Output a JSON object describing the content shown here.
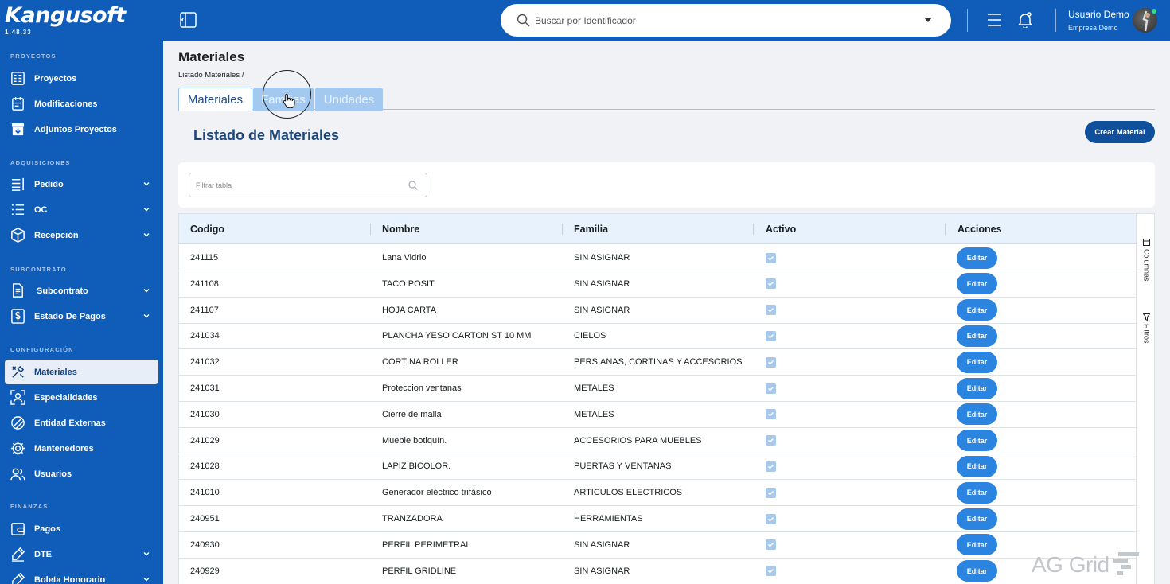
{
  "app": {
    "logo": "Kangusoft",
    "version": "1.48.33"
  },
  "sidebar": {
    "sections": [
      {
        "title": "PROYECTOS",
        "items": [
          {
            "label": "Proyectos",
            "icon": "projects-icon"
          },
          {
            "label": "Modificaciones",
            "icon": "modifications-icon"
          },
          {
            "label": "Adjuntos Proyectos",
            "icon": "attachments-icon"
          }
        ]
      },
      {
        "title": "ADQUISICIONES",
        "items": [
          {
            "label": "Pedido",
            "icon": "order-icon"
          },
          {
            "label": "OC",
            "icon": "purchase-order-icon"
          },
          {
            "label": "Recepción",
            "icon": "reception-icon"
          }
        ]
      },
      {
        "title": "SUBCONTRATO",
        "items": [
          {
            "label": "Subcontrato",
            "icon": "subcontract-icon"
          },
          {
            "label": "Estado De Pagos",
            "icon": "payment-status-icon"
          }
        ]
      },
      {
        "title": "CONFIGURACIÓN",
        "items": [
          {
            "label": "Materiales",
            "icon": "materials-icon"
          },
          {
            "label": "Especialidades",
            "icon": "specialties-icon"
          },
          {
            "label": "Entidad Externas",
            "icon": "external-entities-icon"
          },
          {
            "label": "Mantenedores",
            "icon": "maintainers-icon"
          },
          {
            "label": "Usuarios",
            "icon": "users-icon"
          }
        ]
      },
      {
        "title": "FINANZAS",
        "items": [
          {
            "label": "Pagos",
            "icon": "payments-icon"
          },
          {
            "label": "DTE",
            "icon": "dte-icon"
          },
          {
            "label": "Boleta Honorario",
            "icon": "fee-receipt-icon"
          }
        ]
      }
    ]
  },
  "topbar": {
    "search_placeholder": "Buscar por Identificador",
    "user_name": "Usuario Demo",
    "user_company": "Empresa Demo"
  },
  "page": {
    "title": "Materiales",
    "breadcrumb": "Listado Materiales /",
    "tabs": [
      {
        "label": "Materiales",
        "active": true
      },
      {
        "label": "Familias",
        "active": false
      },
      {
        "label": "Unidades",
        "active": false
      }
    ],
    "list_title": "Listado de Materiales",
    "create_button": "Crear Material",
    "filter_placeholder": "Filtrar tabla"
  },
  "table": {
    "columns": [
      "Codigo",
      "Nombre",
      "Familia",
      "Activo",
      "Acciones"
    ],
    "action_label": "Editar",
    "rows": [
      {
        "codigo": "241115",
        "nombre": "Lana Vidrio",
        "familia": "SIN ASIGNAR",
        "activo": true
      },
      {
        "codigo": "241108",
        "nombre": "TACO POSIT",
        "familia": "SIN ASIGNAR",
        "activo": true
      },
      {
        "codigo": "241107",
        "nombre": "HOJA CARTA",
        "familia": "SIN ASIGNAR",
        "activo": true
      },
      {
        "codigo": "241034",
        "nombre": "PLANCHA YESO CARTON ST 10 MM",
        "familia": "CIELOS",
        "activo": true
      },
      {
        "codigo": "241032",
        "nombre": "CORTINA ROLLER",
        "familia": "PERSIANAS, CORTINAS Y ACCESORIOS",
        "activo": true
      },
      {
        "codigo": "241031",
        "nombre": "Proteccion ventanas",
        "familia": "METALES",
        "activo": true
      },
      {
        "codigo": "241030",
        "nombre": "Cierre de malla",
        "familia": "METALES",
        "activo": true
      },
      {
        "codigo": "241029",
        "nombre": "Mueble botiquín.",
        "familia": "ACCESORIOS PARA MUEBLES",
        "activo": true
      },
      {
        "codigo": "241028",
        "nombre": "LAPIZ BICOLOR.",
        "familia": "PUERTAS Y VENTANAS",
        "activo": true
      },
      {
        "codigo": "241010",
        "nombre": "Generador eléctrico trifásico",
        "familia": "ARTICULOS ELECTRICOS",
        "activo": true
      },
      {
        "codigo": "240951",
        "nombre": "TRANZADORA",
        "familia": "HERRAMIENTAS",
        "activo": true
      },
      {
        "codigo": "240930",
        "nombre": "PERFIL PERIMETRAL",
        "familia": "SIN ASIGNAR",
        "activo": true
      },
      {
        "codigo": "240929",
        "nombre": "PERFIL GRIDLINE",
        "familia": "SIN ASIGNAR",
        "activo": true
      }
    ],
    "side_panel": [
      "Columnas",
      "Filtros"
    ],
    "watermark": "AG Grid"
  }
}
